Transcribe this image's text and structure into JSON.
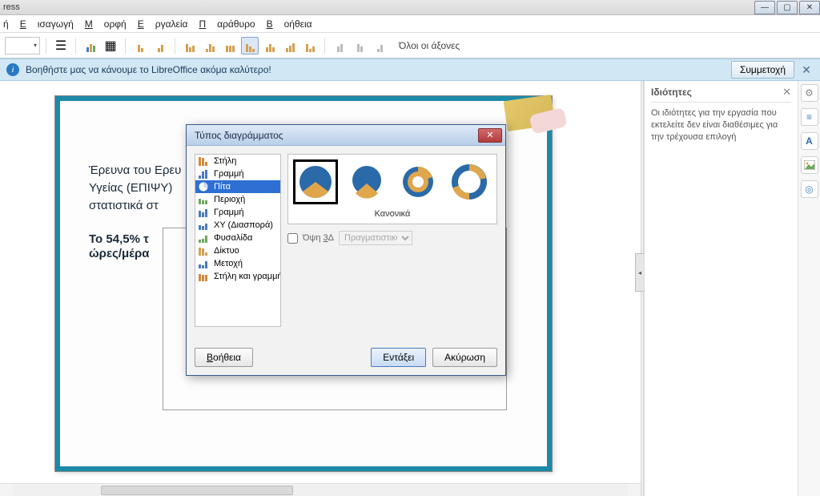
{
  "window": {
    "title_fragment": "ress"
  },
  "menu": {
    "file": "ή",
    "insert": "Εισαγωγή",
    "format": "Μορφή",
    "tools": "Εργαλεία",
    "window": "Παράθυρο",
    "help": "Βοήθεια"
  },
  "toolbar": {
    "all_axes": "Όλοι οι άξονες"
  },
  "infobar": {
    "text": "Βοηθήστε μας να κάνουμε το LibreOffice ακόμα καλύτερο!",
    "participate": "Συμμετοχή"
  },
  "slide": {
    "para1_line1": "Έρευνα του Ερευ",
    "para1_line2": "Υγείας (ΕΠΙΨΥ)",
    "para1_line3": "στατιστικά στ",
    "para2_line1": "Το 54,5% τ",
    "para2_line2": "ώρες/μέρα"
  },
  "dialog": {
    "title": "Τύπος διαγράμματος",
    "types": [
      "Στήλη",
      "Γραμμή",
      "Πίτα",
      "Περιοχή",
      "Γραμμή",
      "XY (Διασπορά)",
      "Φυσαλίδα",
      "Δίκτυο",
      "Μετοχή",
      "Στήλη και γραμμή"
    ],
    "selected_index": 2,
    "variant_label": "Κανονικά",
    "view3d_label": "Όψη 3Δ",
    "view3d_scheme": "Πραγματιστικό",
    "help": "Βοήθεια",
    "ok": "Εντάξει",
    "cancel": "Ακύρωση"
  },
  "sidebar": {
    "title": "Ιδιότητες",
    "body": "Οι ιδιότητες για την εργασία που εκτελείτε δεν είναι διαθέσιμες για την τρέχουσα επιλογή"
  },
  "colors": {
    "accent": "#2e6fd4",
    "pie_blue": "#2a6aa8",
    "pie_gold": "#e0a64c"
  }
}
